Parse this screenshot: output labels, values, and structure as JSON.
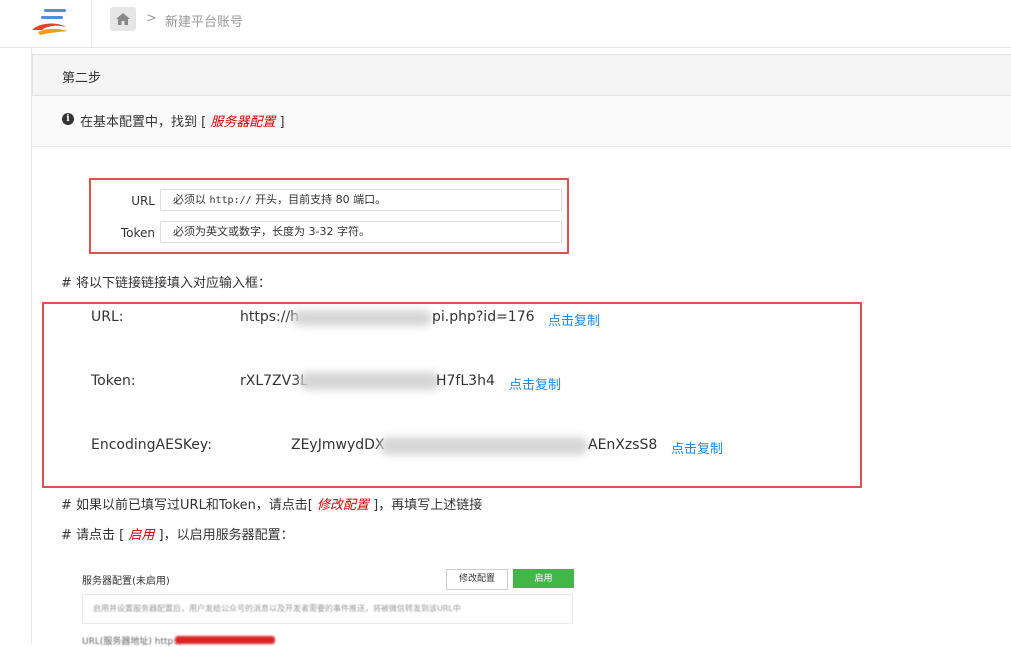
{
  "header": {
    "breadcrumb_sep": ">",
    "page_title": "新建平台账号"
  },
  "panel": {
    "step_title": "第二步",
    "info": {
      "before": "在基本配置中，找到 [ ",
      "highlight": "服务器配置",
      "after": " ]"
    }
  },
  "example_form": {
    "url_label": "URL",
    "url_hint_prefix": "必须以",
    "url_hint_code": "http://",
    "url_hint_suffix": "开头，目前支持 80 端口。",
    "token_label": "Token",
    "token_hint": "必须为英文或数字，长度为 3-32 字符。"
  },
  "instruction_fill": "# 将以下链接链接填入对应输入框：",
  "credentials": {
    "url": {
      "label": "URL:",
      "value_start": "https://h",
      "value_end": "pi.php?id=176",
      "copy_label": "点击复制"
    },
    "token": {
      "label": "Token:",
      "value_start": "rXL7ZV3L",
      "value_end": "H7fL3h4",
      "copy_label": "点击复制"
    },
    "aes": {
      "label": "EncodingAESKey:",
      "value_start": "ZEyJmwydDX",
      "value_end": "AEnXzsS8",
      "copy_label": "点击复制"
    }
  },
  "instruction_modify": {
    "before": "# 如果以前已填写过URL和Token，请点击[ ",
    "highlight": "修改配置",
    "after": " ]，再填写上述链接"
  },
  "instruction_enable": {
    "before": "# 请点击 [ ",
    "highlight": "启用",
    "after": " ]，以启用服务器配置："
  },
  "server_config": {
    "title": "服务器配置(未启用)",
    "modify_button": "修改配置",
    "enable_button": "启用",
    "notice": "启用并设置服务器配置后，用户发给公众号的消息以及开发者需要的事件推送，将被微信转发到该URL中",
    "url_row": "URL(服务器地址)    http://"
  },
  "colors": {
    "highlight_red": "#cc0000",
    "box_red": "#d9534f",
    "link_blue": "#1e88e5",
    "enable_green": "#44b549"
  }
}
